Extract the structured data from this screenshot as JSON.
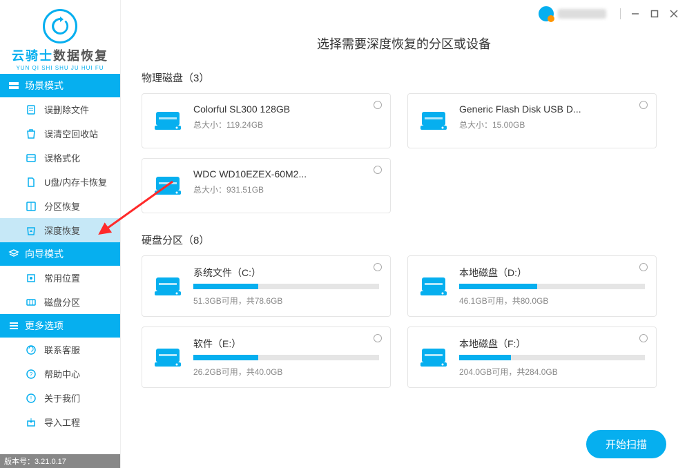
{
  "app": {
    "brand_part1": "云骑士",
    "brand_part2": "数据恢复",
    "brand_sub": "YUN QI SHI SHU JU HUI FU",
    "version_label": "版本号：3.21.0.17"
  },
  "sidebar": {
    "sections": [
      {
        "header": "场景模式",
        "items": [
          {
            "label": "误删除文件",
            "icon": "file-doc"
          },
          {
            "label": "误清空回收站",
            "icon": "recycle-bin"
          },
          {
            "label": "误格式化",
            "icon": "format"
          },
          {
            "label": "U盘/内存卡恢复",
            "icon": "sdcard"
          },
          {
            "label": "分区恢复",
            "icon": "partition"
          },
          {
            "label": "深度恢复",
            "icon": "deep",
            "active": true
          }
        ]
      },
      {
        "header": "向导模式",
        "items": [
          {
            "label": "常用位置",
            "icon": "location"
          },
          {
            "label": "磁盘分区",
            "icon": "disk-part"
          }
        ]
      },
      {
        "header": "更多选项",
        "items": [
          {
            "label": "联系客服",
            "icon": "support"
          },
          {
            "label": "帮助中心",
            "icon": "help"
          },
          {
            "label": "关于我们",
            "icon": "about"
          },
          {
            "label": "导入工程",
            "icon": "import"
          }
        ]
      }
    ]
  },
  "main": {
    "title": "选择需要深度恢复的分区或设备",
    "physical_title": "物理磁盘（3）",
    "partition_title": "硬盘分区（8）",
    "physical": [
      {
        "name": "Colorful SL300 128GB",
        "size": "总大小：119.24GB"
      },
      {
        "name": "Generic Flash Disk USB D...",
        "size": "总大小：15.00GB"
      },
      {
        "name": "WDC WD10EZEX-60M2...",
        "size": "总大小：931.51GB"
      }
    ],
    "partitions": [
      {
        "name": "系统文件（C:）",
        "info": "51.3GB可用，共78.6GB",
        "pct": 35
      },
      {
        "name": "本地磁盘（D:）",
        "info": "46.1GB可用，共80.0GB",
        "pct": 42
      },
      {
        "name": "软件（E:）",
        "info": "26.2GB可用，共40.0GB",
        "pct": 35
      },
      {
        "name": "本地磁盘（F:）",
        "info": "204.0GB可用，共284.0GB",
        "pct": 28
      }
    ],
    "scan_button": "开始扫描"
  }
}
